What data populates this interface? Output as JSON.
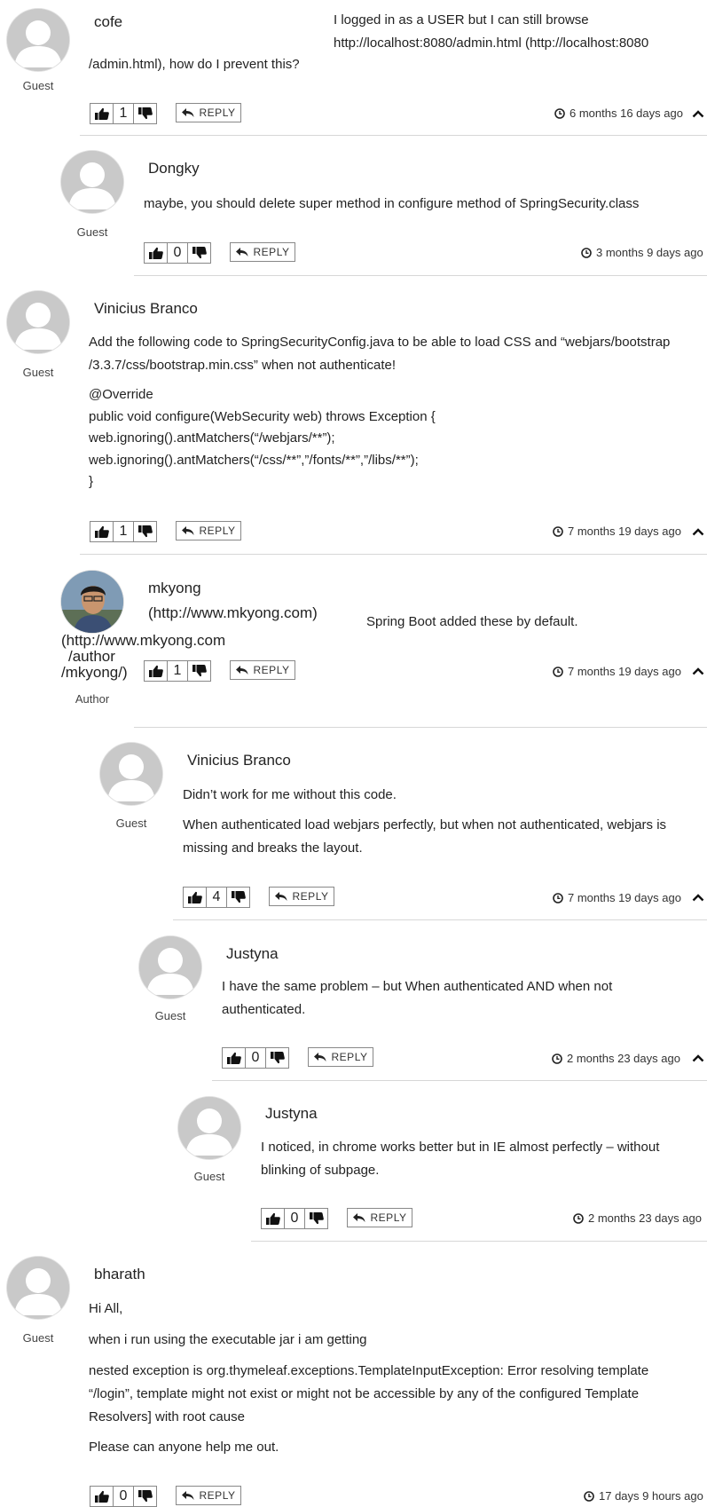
{
  "icons": {
    "like": "thumbs-up-icon",
    "dislike": "thumbs-down-icon",
    "reply": "reply-arrow-icon",
    "clock": "clock-icon",
    "collapse": "chevron-up-icon"
  },
  "reply_label": "REPLY",
  "comments": [
    {
      "name": "cofe",
      "role": "Guest",
      "votes": "1",
      "time": "6 months 16 days ago",
      "text": [
        "I logged in as a USER but I can still browse",
        "http://localhost:8080/admin.html (http://localhost:8080",
        "/admin.html), how do I prevent this?"
      ]
    },
    {
      "name": "Dongky",
      "role": "Guest",
      "votes": "0",
      "time": "3 months 9 days ago",
      "text": [
        "maybe, you should delete super method in configure method of SpringSecurity.class"
      ]
    },
    {
      "name": "Vinicius Branco",
      "role": "Guest",
      "votes": "1",
      "time": "7 months 19 days ago",
      "text": [
        "Add the following code to SpringSecurityConfig.java to be able to load CSS and “webjars/bootstrap",
        "/3.3.7/css/bootstrap.min.css” when not authenticate!"
      ],
      "code": [
        "@Override",
        "public void configure(WebSecurity web) throws Exception {",
        "web.ignoring().antMatchers(“/webjars/**”);",
        "web.ignoring().antMatchers(“/css/**”,”/fonts/**”,”/libs/**”);",
        "}"
      ]
    },
    {
      "name": "mkyong",
      "url": "(http://www.mkyong.com)",
      "author_url": [
        "(http://www.mkyong.com",
        "/author",
        "/mkyong/)"
      ],
      "role": "Author",
      "votes": "1",
      "time": "7 months 19 days ago",
      "text": [
        "Spring Boot added these by default."
      ]
    },
    {
      "name": "Vinicius Branco",
      "role": "Guest",
      "votes": "4",
      "time": "7 months 19 days ago",
      "text": [
        "Didn’t work for me without this code."
      ],
      "text2": [
        "When authenticated load webjars perfectly, but when not authenticated, webjars is",
        "missing and breaks the layout."
      ]
    },
    {
      "name": "Justyna",
      "role": "Guest",
      "votes": "0",
      "time": "2 months 23 days ago",
      "text": [
        "I have the same problem – but When authenticated AND when not",
        "authenticated."
      ]
    },
    {
      "name": "Justyna",
      "role": "Guest",
      "votes": "0",
      "time": "2 months 23 days ago",
      "text": [
        "I noticed, in chrome works better but in IE almost perfectly – without",
        "blinking of subpage."
      ]
    },
    {
      "name": "bharath",
      "role": "Guest",
      "votes": "0",
      "time": "17 days 9 hours ago",
      "text": [
        "Hi All,"
      ],
      "text2": [
        "when i run using the executable jar i am getting"
      ],
      "text3": [
        "nested exception is org.thymeleaf.exceptions.TemplateInputException: Error resolving template",
        "“/login”, template might not exist or might not be accessible by any of the configured Template",
        "Resolvers] with root cause"
      ],
      "text4": [
        "Please can anyone help me out."
      ]
    }
  ]
}
